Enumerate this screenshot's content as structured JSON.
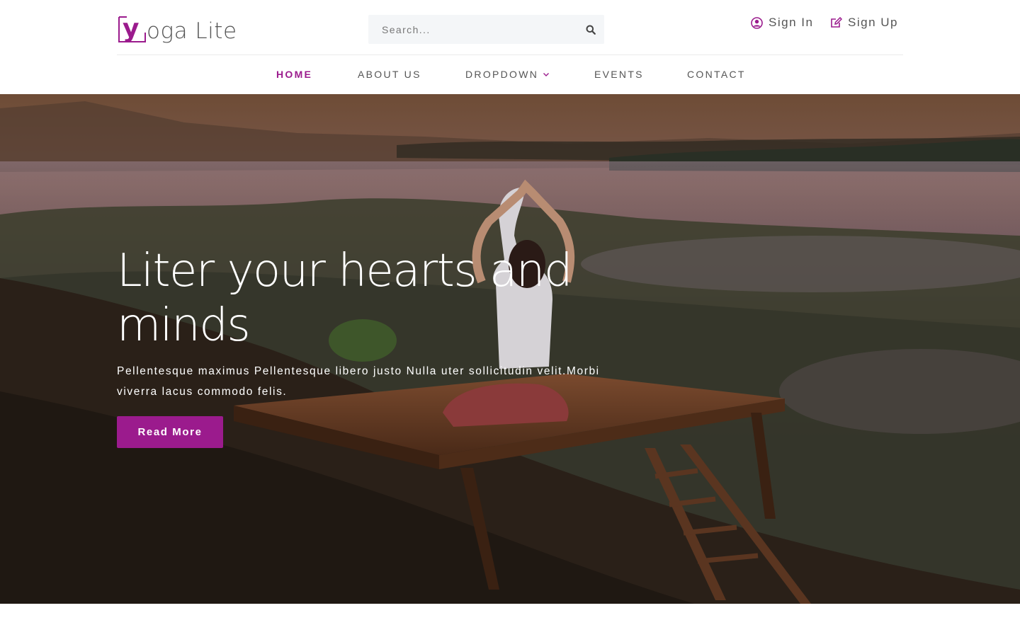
{
  "brand": {
    "logo_letter": "y",
    "name": "oga Lite",
    "accent": "#9b1b8d"
  },
  "search": {
    "placeholder": "Search...",
    "icon": "search-icon"
  },
  "account": {
    "sign_in": {
      "label": "Sign In",
      "icon": "user-circle-icon"
    },
    "sign_up": {
      "label": "Sign Up",
      "icon": "edit-icon"
    }
  },
  "nav": {
    "items": [
      {
        "label": "HOME",
        "active": true
      },
      {
        "label": "ABOUT US"
      },
      {
        "label": "DROPDOWN",
        "icon": "chevron-down-icon"
      },
      {
        "label": "EVENTS"
      },
      {
        "label": "CONTACT"
      }
    ]
  },
  "hero": {
    "title": "Liter your hearts and minds",
    "text": "Pellentesque maximus Pellentesque libero justo Nulla uter sollicitudin velit.Morbi viverra lacus commodo felis.",
    "button": "Read More"
  }
}
